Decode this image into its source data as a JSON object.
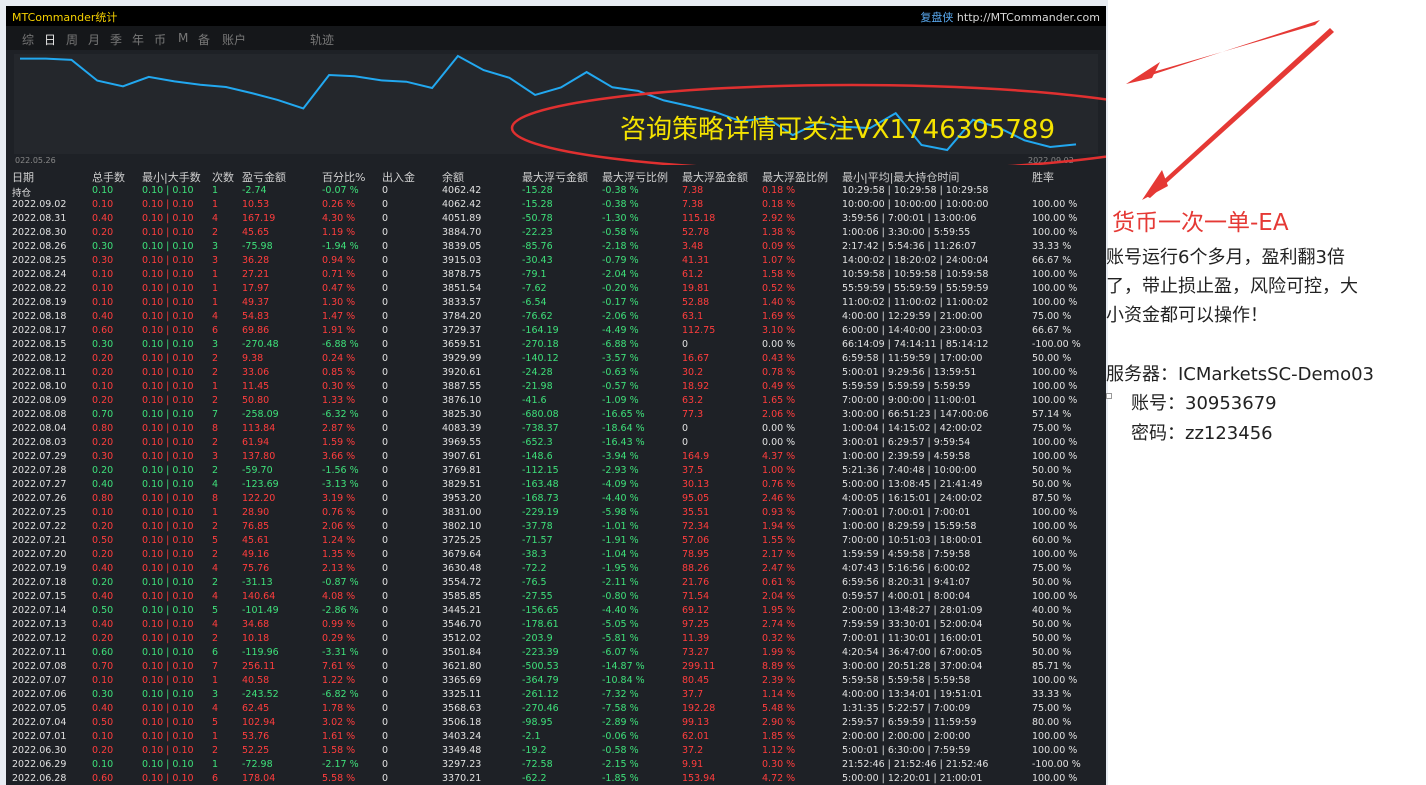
{
  "app": {
    "title": "MTCommander统计",
    "brand_name": "复盘侠",
    "brand_url": "http://MTCommander.com"
  },
  "tabs": [
    {
      "label": "综",
      "active": false
    },
    {
      "label": "日",
      "active": true
    },
    {
      "label": "周",
      "active": false
    },
    {
      "label": "月",
      "active": false
    },
    {
      "label": "季",
      "active": false
    },
    {
      "label": "年",
      "active": false
    },
    {
      "label": "币",
      "active": false
    },
    {
      "label": "M",
      "active": false
    },
    {
      "label": "备",
      "active": false
    },
    {
      "label": "账户",
      "active": false
    },
    {
      "label": "轨迹",
      "active": false
    }
  ],
  "chart_data": {
    "type": "line",
    "x_start_label": "022.05.26",
    "x_end_label": "2022.09.02",
    "values": [
      3370.21,
      3349.48,
      3403.24,
      3506.18,
      3568.63,
      3325.11,
      3365.69,
      3621.8,
      3501.84,
      3512.02,
      3546.7,
      3445.21,
      3585.85,
      3554.72,
      3630.48,
      3679.64,
      3725.25,
      3802.1,
      3831.0,
      3953.2,
      3829.51,
      3769.81,
      3907.61,
      3969.55,
      4083.39,
      3825.3,
      3876.1,
      3887.55,
      3920.61,
      3929.99,
      3659.51,
      3729.37,
      3784.2,
      3833.57,
      3851.54,
      3878.75,
      3915.03,
      3839.05,
      3884.7,
      4051.89,
      4062.42,
      4062.42
    ],
    "color": "#22a8f0"
  },
  "overlay": {
    "text": "咨询策略详情可关注VX1746395789",
    "color": "#f5e300",
    "ellipse_color": "#e03030"
  },
  "table": {
    "headers": [
      "日期",
      "总手数",
      "最小|大手数",
      "次数",
      "盈亏金额",
      "百分比%",
      "出入金",
      "余额",
      "最大浮亏金额",
      "最大浮亏比例",
      "最大浮盈金额",
      "最大浮盈比例",
      "最小|平均|最大持仓时间",
      "胜率"
    ],
    "rows": [
      [
        "持仓",
        "0.10",
        "0.10 | 0.10",
        "1",
        "-2.74",
        "-0.07 %",
        "0",
        "4062.42",
        "-15.28",
        "-0.38 %",
        "7.38",
        "0.18 %",
        "10:29:58 | 10:29:58 | 10:29:58",
        ""
      ],
      [
        "2022.09.02",
        "0.10",
        "0.10 | 0.10",
        "1",
        "10.53",
        "0.26 %",
        "0",
        "4062.42",
        "-15.28",
        "-0.38 %",
        "7.38",
        "0.18 %",
        "10:00:00 | 10:00:00 | 10:00:00",
        "100.00 %"
      ],
      [
        "2022.08.31",
        "0.40",
        "0.10 | 0.10",
        "4",
        "167.19",
        "4.30 %",
        "0",
        "4051.89",
        "-50.78",
        "-1.30 %",
        "115.18",
        "2.92 %",
        "3:59:56 | 7:00:01 | 13:00:06",
        "100.00 %"
      ],
      [
        "2022.08.30",
        "0.20",
        "0.10 | 0.10",
        "2",
        "45.65",
        "1.19 %",
        "0",
        "3884.70",
        "-22.23",
        "-0.58 %",
        "52.78",
        "1.38 %",
        "1:00:06 | 3:30:00 | 5:59:55",
        "100.00 %"
      ],
      [
        "2022.08.26",
        "0.30",
        "0.10 | 0.10",
        "3",
        "-75.98",
        "-1.94 %",
        "0",
        "3839.05",
        "-85.76",
        "-2.18 %",
        "3.48",
        "0.09 %",
        "2:17:42 | 5:54:36 | 11:26:07",
        "33.33 %"
      ],
      [
        "2022.08.25",
        "0.30",
        "0.10 | 0.10",
        "3",
        "36.28",
        "0.94 %",
        "0",
        "3915.03",
        "-30.43",
        "-0.79 %",
        "41.31",
        "1.07 %",
        "14:00:02 | 18:20:02 | 24:00:04",
        "66.67 %"
      ],
      [
        "2022.08.24",
        "0.10",
        "0.10 | 0.10",
        "1",
        "27.21",
        "0.71 %",
        "0",
        "3878.75",
        "-79.1",
        "-2.04 %",
        "61.2",
        "1.58 %",
        "10:59:58 | 10:59:58 | 10:59:58",
        "100.00 %"
      ],
      [
        "2022.08.22",
        "0.10",
        "0.10 | 0.10",
        "1",
        "17.97",
        "0.47 %",
        "0",
        "3851.54",
        "-7.62",
        "-0.20 %",
        "19.81",
        "0.52 %",
        "55:59:59 | 55:59:59 | 55:59:59",
        "100.00 %"
      ],
      [
        "2022.08.19",
        "0.10",
        "0.10 | 0.10",
        "1",
        "49.37",
        "1.30 %",
        "0",
        "3833.57",
        "-6.54",
        "-0.17 %",
        "52.88",
        "1.40 %",
        "11:00:02 | 11:00:02 | 11:00:02",
        "100.00 %"
      ],
      [
        "2022.08.18",
        "0.40",
        "0.10 | 0.10",
        "4",
        "54.83",
        "1.47 %",
        "0",
        "3784.20",
        "-76.62",
        "-2.06 %",
        "63.1",
        "1.69 %",
        "4:00:00 | 12:29:59 | 21:00:00",
        "75.00 %"
      ],
      [
        "2022.08.17",
        "0.60",
        "0.10 | 0.10",
        "6",
        "69.86",
        "1.91 %",
        "0",
        "3729.37",
        "-164.19",
        "-4.49 %",
        "112.75",
        "3.10 %",
        "6:00:00 | 14:40:00 | 23:00:03",
        "66.67 %"
      ],
      [
        "2022.08.15",
        "0.30",
        "0.10 | 0.10",
        "3",
        "-270.48",
        "-6.88 %",
        "0",
        "3659.51",
        "-270.18",
        "-6.88 %",
        "0",
        "0.00 %",
        "66:14:09 | 74:14:11 | 85:14:12",
        "-100.00 %"
      ],
      [
        "2022.08.12",
        "0.20",
        "0.10 | 0.10",
        "2",
        "9.38",
        "0.24 %",
        "0",
        "3929.99",
        "-140.12",
        "-3.57 %",
        "16.67",
        "0.43 %",
        "6:59:58 | 11:59:59 | 17:00:00",
        "50.00 %"
      ],
      [
        "2022.08.11",
        "0.20",
        "0.10 | 0.10",
        "2",
        "33.06",
        "0.85 %",
        "0",
        "3920.61",
        "-24.28",
        "-0.63 %",
        "30.2",
        "0.78 %",
        "5:00:01 | 9:29:56 | 13:59:51",
        "100.00 %"
      ],
      [
        "2022.08.10",
        "0.10",
        "0.10 | 0.10",
        "1",
        "11.45",
        "0.30 %",
        "0",
        "3887.55",
        "-21.98",
        "-0.57 %",
        "18.92",
        "0.49 %",
        "5:59:59 | 5:59:59 | 5:59:59",
        "100.00 %"
      ],
      [
        "2022.08.09",
        "0.20",
        "0.10 | 0.10",
        "2",
        "50.80",
        "1.33 %",
        "0",
        "3876.10",
        "-41.6",
        "-1.09 %",
        "63.2",
        "1.65 %",
        "7:00:00 | 9:00:00 | 11:00:01",
        "100.00 %"
      ],
      [
        "2022.08.08",
        "0.70",
        "0.10 | 0.10",
        "7",
        "-258.09",
        "-6.32 %",
        "0",
        "3825.30",
        "-680.08",
        "-16.65 %",
        "77.3",
        "2.06 %",
        "3:00:00 | 66:51:23 | 147:00:06",
        "57.14 %"
      ],
      [
        "2022.08.04",
        "0.80",
        "0.10 | 0.10",
        "8",
        "113.84",
        "2.87 %",
        "0",
        "4083.39",
        "-738.37",
        "-18.64 %",
        "0",
        "0.00 %",
        "1:00:04 | 14:15:02 | 42:00:02",
        "75.00 %"
      ],
      [
        "2022.08.03",
        "0.20",
        "0.10 | 0.10",
        "2",
        "61.94",
        "1.59 %",
        "0",
        "3969.55",
        "-652.3",
        "-16.43 %",
        "0",
        "0.00 %",
        "3:00:01 | 6:29:57 | 9:59:54",
        "100.00 %"
      ],
      [
        "2022.07.29",
        "0.30",
        "0.10 | 0.10",
        "3",
        "137.80",
        "3.66 %",
        "0",
        "3907.61",
        "-148.6",
        "-3.94 %",
        "164.9",
        "4.37 %",
        "1:00:00 | 2:39:59 | 4:59:58",
        "100.00 %"
      ],
      [
        "2022.07.28",
        "0.20",
        "0.10 | 0.10",
        "2",
        "-59.70",
        "-1.56 %",
        "0",
        "3769.81",
        "-112.15",
        "-2.93 %",
        "37.5",
        "1.00 %",
        "5:21:36 | 7:40:48 | 10:00:00",
        "50.00 %"
      ],
      [
        "2022.07.27",
        "0.40",
        "0.10 | 0.10",
        "4",
        "-123.69",
        "-3.13 %",
        "0",
        "3829.51",
        "-163.48",
        "-4.09 %",
        "30.13",
        "0.76 %",
        "5:00:00 | 13:08:45 | 21:41:49",
        "50.00 %"
      ],
      [
        "2022.07.26",
        "0.80",
        "0.10 | 0.10",
        "8",
        "122.20",
        "3.19 %",
        "0",
        "3953.20",
        "-168.73",
        "-4.40 %",
        "95.05",
        "2.46 %",
        "4:00:05 | 16:15:01 | 24:00:02",
        "87.50 %"
      ],
      [
        "2022.07.25",
        "0.10",
        "0.10 | 0.10",
        "1",
        "28.90",
        "0.76 %",
        "0",
        "3831.00",
        "-229.19",
        "-5.98 %",
        "35.51",
        "0.93 %",
        "7:00:01 | 7:00:01 | 7:00:01",
        "100.00 %"
      ],
      [
        "2022.07.22",
        "0.20",
        "0.10 | 0.10",
        "2",
        "76.85",
        "2.06 %",
        "0",
        "3802.10",
        "-37.78",
        "-1.01 %",
        "72.34",
        "1.94 %",
        "1:00:00 | 8:29:59 | 15:59:58",
        "100.00 %"
      ],
      [
        "2022.07.21",
        "0.50",
        "0.10 | 0.10",
        "5",
        "45.61",
        "1.24 %",
        "0",
        "3725.25",
        "-71.57",
        "-1.91 %",
        "57.06",
        "1.55 %",
        "7:00:00 | 10:51:03 | 18:00:01",
        "60.00 %"
      ],
      [
        "2022.07.20",
        "0.20",
        "0.10 | 0.10",
        "2",
        "49.16",
        "1.35 %",
        "0",
        "3679.64",
        "-38.3",
        "-1.04 %",
        "78.95",
        "2.17 %",
        "1:59:59 | 4:59:58 | 7:59:58",
        "100.00 %"
      ],
      [
        "2022.07.19",
        "0.40",
        "0.10 | 0.10",
        "4",
        "75.76",
        "2.13 %",
        "0",
        "3630.48",
        "-72.2",
        "-1.95 %",
        "88.26",
        "2.47 %",
        "4:07:43 | 5:16:56 | 6:00:02",
        "75.00 %"
      ],
      [
        "2022.07.18",
        "0.20",
        "0.10 | 0.10",
        "2",
        "-31.13",
        "-0.87 %",
        "0",
        "3554.72",
        "-76.5",
        "-2.11 %",
        "21.76",
        "0.61 %",
        "6:59:56 | 8:20:31 | 9:41:07",
        "50.00 %"
      ],
      [
        "2022.07.15",
        "0.40",
        "0.10 | 0.10",
        "4",
        "140.64",
        "4.08 %",
        "0",
        "3585.85",
        "-27.55",
        "-0.80 %",
        "71.54",
        "2.04 %",
        "0:59:57 | 4:00:01 | 8:00:04",
        "100.00 %"
      ],
      [
        "2022.07.14",
        "0.50",
        "0.10 | 0.10",
        "5",
        "-101.49",
        "-2.86 %",
        "0",
        "3445.21",
        "-156.65",
        "-4.40 %",
        "69.12",
        "1.95 %",
        "2:00:00 | 13:48:27 | 28:01:09",
        "40.00 %"
      ],
      [
        "2022.07.13",
        "0.40",
        "0.10 | 0.10",
        "4",
        "34.68",
        "0.99 %",
        "0",
        "3546.70",
        "-178.61",
        "-5.05 %",
        "97.25",
        "2.74 %",
        "7:59:59 | 33:30:01 | 52:00:04",
        "50.00 %"
      ],
      [
        "2022.07.12",
        "0.20",
        "0.10 | 0.10",
        "2",
        "10.18",
        "0.29 %",
        "0",
        "3512.02",
        "-203.9",
        "-5.81 %",
        "11.39",
        "0.32 %",
        "7:00:01 | 11:30:01 | 16:00:01",
        "50.00 %"
      ],
      [
        "2022.07.11",
        "0.60",
        "0.10 | 0.10",
        "6",
        "-119.96",
        "-3.31 %",
        "0",
        "3501.84",
        "-223.39",
        "-6.07 %",
        "73.27",
        "1.99 %",
        "4:20:54 | 36:47:00 | 67:00:05",
        "50.00 %"
      ],
      [
        "2022.07.08",
        "0.70",
        "0.10 | 0.10",
        "7",
        "256.11",
        "7.61 %",
        "0",
        "3621.80",
        "-500.53",
        "-14.87 %",
        "299.11",
        "8.89 %",
        "3:00:00 | 20:51:28 | 37:00:04",
        "85.71 %"
      ],
      [
        "2022.07.07",
        "0.10",
        "0.10 | 0.10",
        "1",
        "40.58",
        "1.22 %",
        "0",
        "3365.69",
        "-364.79",
        "-10.84 %",
        "80.45",
        "2.39 %",
        "5:59:58 | 5:59:58 | 5:59:58",
        "100.00 %"
      ],
      [
        "2022.07.06",
        "0.30",
        "0.10 | 0.10",
        "3",
        "-243.52",
        "-6.82 %",
        "0",
        "3325.11",
        "-261.12",
        "-7.32 %",
        "37.7",
        "1.14 %",
        "4:00:00 | 13:34:01 | 19:51:01",
        "33.33 %"
      ],
      [
        "2022.07.05",
        "0.40",
        "0.10 | 0.10",
        "4",
        "62.45",
        "1.78 %",
        "0",
        "3568.63",
        "-270.46",
        "-7.58 %",
        "192.28",
        "5.48 %",
        "1:31:35 | 5:22:57 | 7:00:09",
        "75.00 %"
      ],
      [
        "2022.07.04",
        "0.50",
        "0.10 | 0.10",
        "5",
        "102.94",
        "3.02 %",
        "0",
        "3506.18",
        "-98.95",
        "-2.89 %",
        "99.13",
        "2.90 %",
        "2:59:57 | 6:59:59 | 11:59:59",
        "80.00 %"
      ],
      [
        "2022.07.01",
        "0.10",
        "0.10 | 0.10",
        "1",
        "53.76",
        "1.61 %",
        "0",
        "3403.24",
        "-2.1",
        "-0.06 %",
        "62.01",
        "1.85 %",
        "2:00:00 | 2:00:00 | 2:00:00",
        "100.00 %"
      ],
      [
        "2022.06.30",
        "0.20",
        "0.10 | 0.10",
        "2",
        "52.25",
        "1.58 %",
        "0",
        "3349.48",
        "-19.2",
        "-0.58 %",
        "37.2",
        "1.12 %",
        "5:00:01 | 6:30:00 | 7:59:59",
        "100.00 %"
      ],
      [
        "2022.06.29",
        "0.10",
        "0.10 | 0.10",
        "1",
        "-72.98",
        "-2.17 %",
        "0",
        "3297.23",
        "-72.58",
        "-2.15 %",
        "9.91",
        "0.30 %",
        "21:52:46 | 21:52:46 | 21:52:46",
        "-100.00 %"
      ],
      [
        "2022.06.28",
        "0.60",
        "0.10 | 0.10",
        "6",
        "178.04",
        "5.58 %",
        "0",
        "3370.21",
        "-62.2",
        "-1.85 %",
        "153.94",
        "4.72 %",
        "5:00:00 | 12:20:01 | 21:00:01",
        "100.00 %"
      ]
    ]
  },
  "annotation": {
    "title": "货币一次一单-EA",
    "title_color": "#e53935",
    "desc_lines": [
      "账号运行6个多月，盈利翻3倍",
      "了，带止损止盈，风险可控，大",
      "小资金都可以操作！"
    ],
    "server_label": "服务器：ICMarketsSC-Demo03",
    "account_label": "账号：30953679",
    "password_label": "密码：zz123456",
    "arrow_color": "#e53935"
  }
}
